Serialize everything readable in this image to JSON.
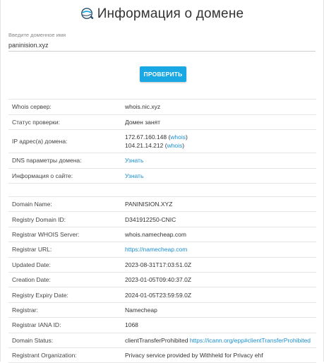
{
  "header": {
    "title": "Информация о домене",
    "logo_icon": "globe-magnifier-icon"
  },
  "form": {
    "label": "Введите доменное имя",
    "value": "paninision.xyz",
    "button_label": "ПРОВЕРИТЬ"
  },
  "summary": {
    "whois_server_label": "Whois сервер:",
    "whois_server_value": "whois.nic.xyz",
    "status_label": "Статус проверки:",
    "status_value": "Домен занят",
    "ip_label": "IP адрес(а) домена:",
    "ips": [
      {
        "ip": "172.67.160.148",
        "link": "whois"
      },
      {
        "ip": "104.21.14.212",
        "link": "whois"
      }
    ],
    "dns_label": "DNS параметры домена:",
    "dns_link": "Узнать",
    "site_label": "Информация о сайте:",
    "site_link": "Узнать"
  },
  "whois": {
    "domain_name_label": "Domain Name:",
    "domain_name": "PANINISION.XYZ",
    "registry_id_label": "Registry Domain ID:",
    "registry_id": "D341912250-CNIC",
    "whois_server_label": "Registrar WHOIS Server:",
    "whois_server": "whois.namecheap.com",
    "registrar_url_label": "Registrar URL:",
    "registrar_url": "https://namecheap.com",
    "updated_label": "Updated Date:",
    "updated": "2023-08-31T17:03:51.0Z",
    "creation_label": "Creation Date:",
    "creation": "2023-01-05T09:40:37.0Z",
    "expiry_label": "Registry Expiry Date:",
    "expiry": "2024-01-05T23:59:59.0Z",
    "registrar_label": "Registrar:",
    "registrar": "Namecheap",
    "iana_label": "Registrar IANA ID:",
    "iana": "1068",
    "status_label": "Domain Status:",
    "status_text": "clientTransferProhibited",
    "status_link": "https://icann.org/epp#clientTransferProhibited",
    "org_label": "Registrant Organization:",
    "org": "Privacy service provided by Withheld for Privacy ehf"
  },
  "colors": {
    "accent": "#19a8e3",
    "link": "#1a8fd0"
  }
}
